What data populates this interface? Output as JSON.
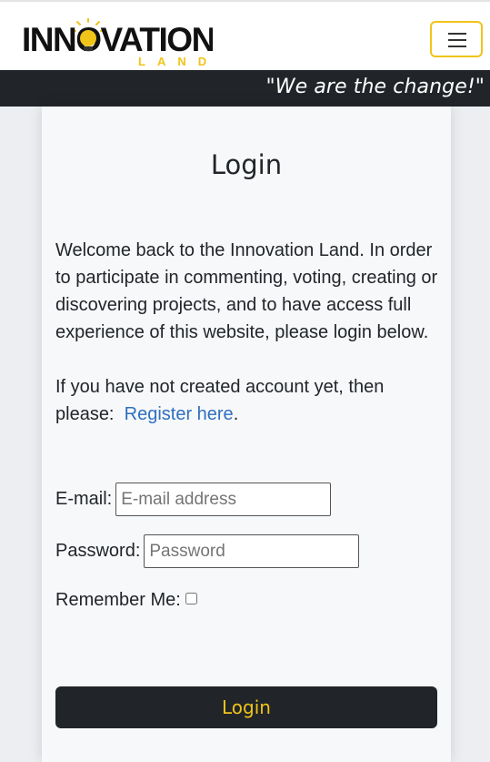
{
  "header": {
    "logo_text_main": "INNOVATION",
    "logo_text_sub": "LAND",
    "menu_icon": "hamburger-icon",
    "slogan": "\"We are the change!\""
  },
  "login": {
    "title": "Login",
    "intro": "Welcome back to the Innovation Land. In order to participate in commenting, voting, creating or discovering projects, and to have access full experience of this website, please login below.",
    "register_prefix": "If you have not created account yet, then please:",
    "register_link": "Register here",
    "register_suffix": ".",
    "email_label": "E-mail:",
    "email_placeholder": "E-mail address",
    "email_value": "",
    "password_label": "Password:",
    "password_placeholder": "Password",
    "password_value": "",
    "remember_label": "Remember Me:",
    "remember_checked": false,
    "submit_label": "Login"
  },
  "colors": {
    "accent": "#f0c419",
    "dark": "#212529",
    "link": "#2f6fbf",
    "card_bg": "#f7f8fa"
  }
}
